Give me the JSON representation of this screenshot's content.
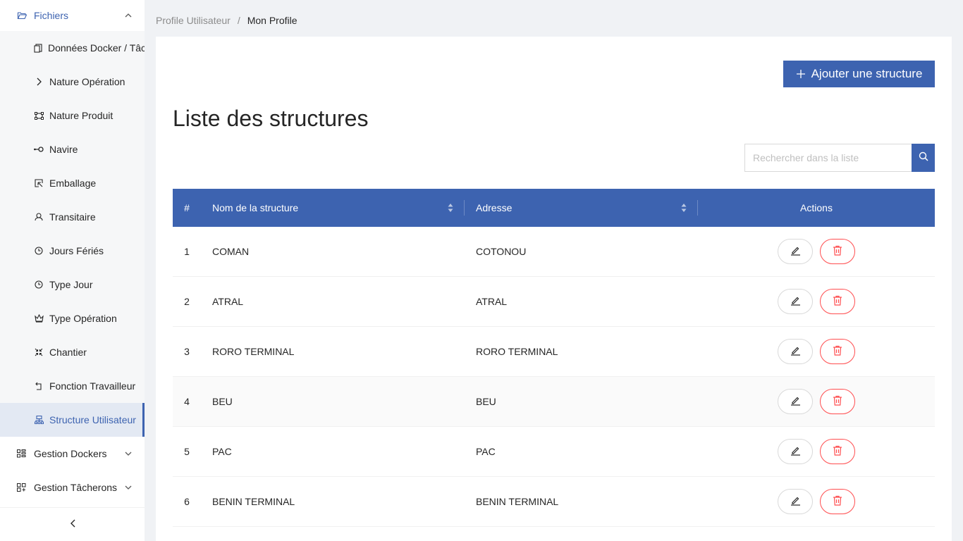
{
  "sidebar": {
    "section_title": "Fichiers",
    "items": [
      {
        "label": "Données Docker / Tâcherons",
        "icon": "copy-icon"
      },
      {
        "label": "Nature Opération",
        "icon": "chevron-right-icon"
      },
      {
        "label": "Nature Produit",
        "icon": "border-icon"
      },
      {
        "label": "Navire",
        "icon": "node-icon"
      },
      {
        "label": "Emballage",
        "icon": "select-icon"
      },
      {
        "label": "Transitaire",
        "icon": "user-switch-icon"
      },
      {
        "label": "Jours Fériés",
        "icon": "clock-icon"
      },
      {
        "label": "Type Jour",
        "icon": "clock-icon"
      },
      {
        "label": "Type Opération",
        "icon": "crown-icon"
      },
      {
        "label": "Chantier",
        "icon": "compress-icon"
      },
      {
        "label": "Fonction Travailleur",
        "icon": "rollback-icon"
      },
      {
        "label": "Structure Utilisateur",
        "icon": "cluster-icon"
      }
    ],
    "groups": [
      {
        "label": "Gestion Dockers"
      },
      {
        "label": "Gestion Tâcherons"
      }
    ]
  },
  "breadcrumb": {
    "parent": "Profile Utilisateur",
    "separator": "/",
    "current": "Mon Profile"
  },
  "page": {
    "add_button": "Ajouter une structure",
    "title": "Liste des structures",
    "search_placeholder": "Rechercher dans la liste"
  },
  "table": {
    "columns": [
      "#",
      "Nom de la structure",
      "Adresse",
      "Actions"
    ],
    "rows": [
      {
        "num": "1",
        "name": "COMAN",
        "address": "COTONOU"
      },
      {
        "num": "2",
        "name": "ATRAL",
        "address": "ATRAL"
      },
      {
        "num": "3",
        "name": "RORO TERMINAL",
        "address": "RORO TERMINAL"
      },
      {
        "num": "4",
        "name": "BEU",
        "address": "BEU"
      },
      {
        "num": "5",
        "name": "PAC",
        "address": "PAC"
      },
      {
        "num": "6",
        "name": "BENIN TERMINAL",
        "address": "BENIN TERMINAL"
      }
    ]
  },
  "colors": {
    "primary": "#3d63b0",
    "danger": "#ff4d4f"
  }
}
